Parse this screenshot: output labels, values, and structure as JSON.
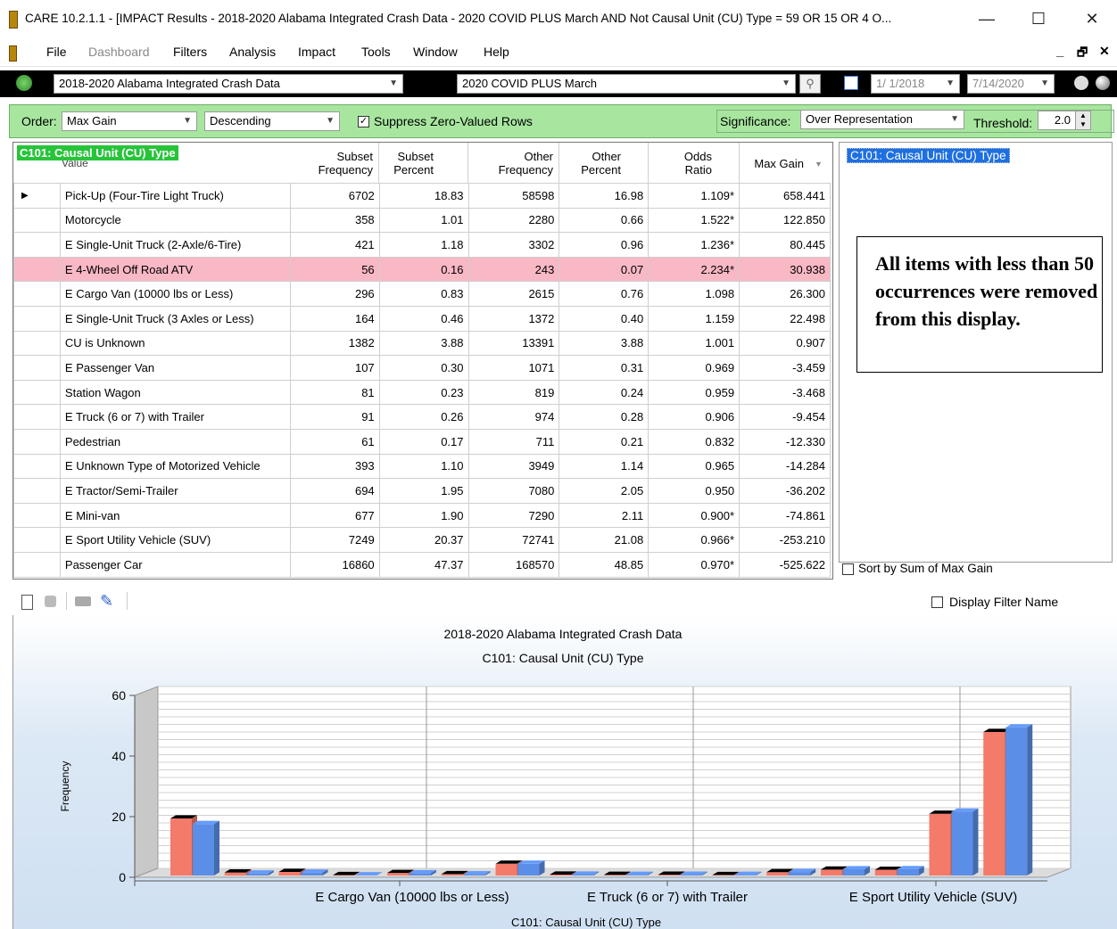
{
  "window": {
    "title": "CARE 10.2.1.1 - [IMPACT Results - 2018-2020 Alabama Integrated Crash Data - 2020 COVID PLUS March AND Not Causal Unit (CU) Type = 59 OR 15 OR 4 O...",
    "minimize": "—",
    "maximize": "☐",
    "close": "✕",
    "mdi_min": "_",
    "mdi_restore": "🗗",
    "mdi_close": "✕"
  },
  "menu": [
    "File",
    "Dashboard",
    "Filters",
    "Analysis",
    "Impact",
    "Tools",
    "Window",
    "Help"
  ],
  "toolbar": {
    "dataset": "2018-2020 Alabama Integrated Crash Data",
    "filter": "2020 COVID PLUS March",
    "date_from": "1/ 1/2018",
    "date_to": "7/14/2020"
  },
  "options": {
    "order_label": "Order:",
    "order_value": "Max Gain",
    "direction_value": "Descending",
    "suppress_label": "Suppress Zero-Valued Rows",
    "suppress_checked": "✓",
    "significance_label": "Significance:",
    "significance_value": "Over Representation",
    "threshold_label": "Threshold:",
    "threshold_value": "2.0"
  },
  "table": {
    "variable_label": "C101: Causal Unit (CU) Type",
    "value_col": "Value",
    "columns": [
      {
        "line1": "Subset",
        "line2": "Frequency"
      },
      {
        "line1": "Subset",
        "line2": "Percent"
      },
      {
        "line1": "Other",
        "line2": "Frequency"
      },
      {
        "line1": "Other",
        "line2": "Percent"
      },
      {
        "line1": "Odds",
        "line2": "Ratio"
      },
      {
        "line1": "Max Gain",
        "line2": ""
      }
    ],
    "rows": [
      {
        "value": "Pick-Up (Four-Tire Light Truck)",
        "sf": "6702",
        "sp": "18.83",
        "of": "58598",
        "op": "16.98",
        "or": "1.109*",
        "mg": "658.441"
      },
      {
        "value": "Motorcycle",
        "sf": "358",
        "sp": "1.01",
        "of": "2280",
        "op": "0.66",
        "or": "1.522*",
        "mg": "122.850"
      },
      {
        "value": "E Single-Unit Truck (2-Axle/6-Tire)",
        "sf": "421",
        "sp": "1.18",
        "of": "3302",
        "op": "0.96",
        "or": "1.236*",
        "mg": "80.445"
      },
      {
        "value": "E 4-Wheel Off Road ATV",
        "sf": "56",
        "sp": "0.16",
        "of": "243",
        "op": "0.07",
        "or": "2.234*",
        "mg": "30.938"
      },
      {
        "value": "E Cargo Van (10000 lbs or Less)",
        "sf": "296",
        "sp": "0.83",
        "of": "2615",
        "op": "0.76",
        "or": "1.098",
        "mg": "26.300"
      },
      {
        "value": "E Single-Unit Truck (3 Axles or Less)",
        "sf": "164",
        "sp": "0.46",
        "of": "1372",
        "op": "0.40",
        "or": "1.159",
        "mg": "22.498"
      },
      {
        "value": "CU is Unknown",
        "sf": "1382",
        "sp": "3.88",
        "of": "13391",
        "op": "3.88",
        "or": "1.001",
        "mg": "0.907"
      },
      {
        "value": "E Passenger Van",
        "sf": "107",
        "sp": "0.30",
        "of": "1071",
        "op": "0.31",
        "or": "0.969",
        "mg": "-3.459"
      },
      {
        "value": "Station Wagon",
        "sf": "81",
        "sp": "0.23",
        "of": "819",
        "op": "0.24",
        "or": "0.959",
        "mg": "-3.468"
      },
      {
        "value": "E Truck (6 or 7) with Trailer",
        "sf": "91",
        "sp": "0.26",
        "of": "974",
        "op": "0.28",
        "or": "0.906",
        "mg": "-9.454"
      },
      {
        "value": "Pedestrian",
        "sf": "61",
        "sp": "0.17",
        "of": "711",
        "op": "0.21",
        "or": "0.832",
        "mg": "-12.330"
      },
      {
        "value": "E Unknown Type of Motorized Vehicle",
        "sf": "393",
        "sp": "1.10",
        "of": "3949",
        "op": "1.14",
        "or": "0.965",
        "mg": "-14.284"
      },
      {
        "value": "E Tractor/Semi-Trailer",
        "sf": "694",
        "sp": "1.95",
        "of": "7080",
        "op": "2.05",
        "or": "0.950",
        "mg": "-36.202"
      },
      {
        "value": "E Mini-van",
        "sf": "677",
        "sp": "1.90",
        "of": "7290",
        "op": "2.11",
        "or": "0.900*",
        "mg": "-74.861"
      },
      {
        "value": "E Sport Utility Vehicle (SUV)",
        "sf": "7249",
        "sp": "20.37",
        "of": "72741",
        "op": "21.08",
        "or": "0.966*",
        "mg": "-253.210"
      },
      {
        "value": "Passenger Car",
        "sf": "16860",
        "sp": "47.37",
        "of": "168570",
        "op": "48.85",
        "or": "0.970*",
        "mg": "-525.622"
      }
    ],
    "highlight_row": 3,
    "highlight_color": "#f8b8c4"
  },
  "right_panel": {
    "variable_label": "C101: Causal Unit (CU) Type",
    "note": "All items with less than 50 occurrences were removed from this display.",
    "sort_label": "Sort by Sum of Max Gain"
  },
  "chart_toolbar": {
    "display_filter_label": "Display Filter Name"
  },
  "chart_data": {
    "type": "bar",
    "title": "2018-2020 Alabama Integrated Crash Data",
    "subtitle": "C101: Causal Unit (CU) Type",
    "xlabel": "C101: Causal Unit (CU) Type",
    "ylabel": "Frequency",
    "ylim": [
      0,
      60
    ],
    "yticks": [
      0,
      20,
      40,
      60
    ],
    "xtick_labels": [
      "E Cargo Van (10000 lbs or Less)",
      "E Truck (6 or 7) with Trailer",
      "E Sport Utility Vehicle (SUV)"
    ],
    "grid": true,
    "categories": [
      "Pick-Up (Four-Tire Light Truck)",
      "Motorcycle",
      "E Single-Unit Truck (2-Axle/6-Tire)",
      "E 4-Wheel Off Road ATV",
      "E Cargo Van (10000 lbs or Less)",
      "E Single-Unit Truck (3 Axles or Less)",
      "CU is Unknown",
      "E Passenger Van",
      "Station Wagon",
      "E Truck (6 or 7) with Trailer",
      "Pedestrian",
      "E Unknown Type of Motorized Vehicle",
      "E Tractor/Semi-Trailer",
      "E Mini-van",
      "E Sport Utility Vehicle (SUV)",
      "Passenger Car"
    ],
    "series": [
      {
        "values": [
          18.83,
          1.01,
          1.18,
          0.16,
          0.83,
          0.46,
          3.88,
          0.3,
          0.23,
          0.26,
          0.17,
          1.1,
          1.95,
          1.9,
          20.37,
          47.37
        ],
        "color": "#f47a6a"
      },
      {
        "values": [
          16.98,
          0.66,
          0.96,
          0.07,
          0.76,
          0.4,
          3.88,
          0.31,
          0.24,
          0.28,
          0.21,
          1.14,
          2.05,
          2.11,
          21.08,
          48.85
        ],
        "color": "#5b8ee6"
      }
    ]
  }
}
